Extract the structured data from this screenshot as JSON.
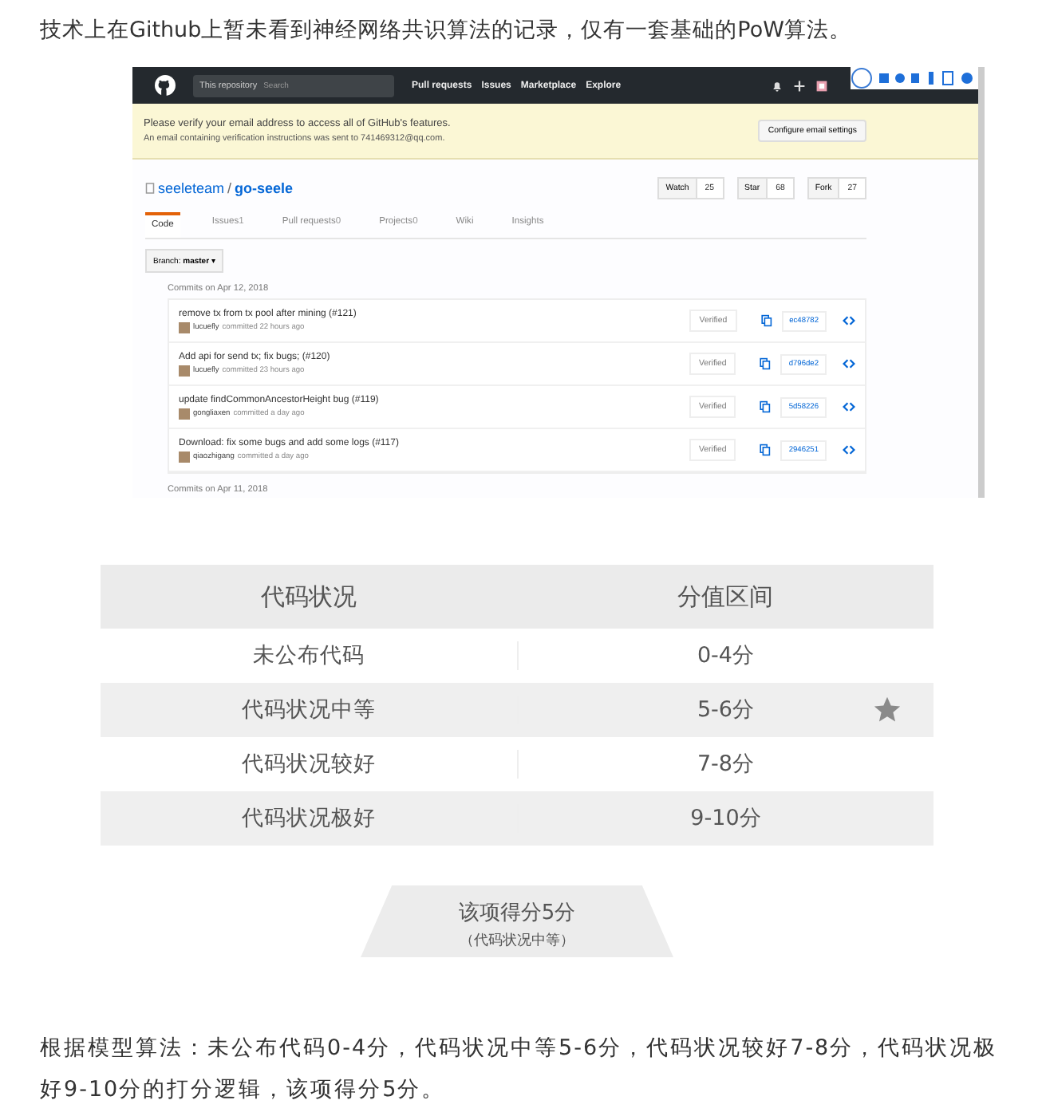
{
  "intro": "技术上在Github上暂未看到神经网络共识算法的记录，仅有一套基础的PoW算法。",
  "screenshot": {
    "nav": {
      "scope": "This repository",
      "search_placeholder": "Search",
      "links": [
        "Pull requests",
        "Issues",
        "Marketplace",
        "Explore"
      ]
    },
    "flash": {
      "title": "Please verify your email address to access all of GitHub's features.",
      "body": "An email containing verification instructions was sent to 741469312@qq.com.",
      "button": "Configure email settings"
    },
    "repo": {
      "owner": "seeleteam",
      "separator": "/",
      "name": "go-seele",
      "actions": [
        {
          "label": "Watch",
          "count": "25"
        },
        {
          "label": "Star",
          "count": "68"
        },
        {
          "label": "Fork",
          "count": "27"
        }
      ]
    },
    "tabs": [
      {
        "label": "Code",
        "selected": true
      },
      {
        "label": "Issues",
        "count": "1",
        "selected": false
      },
      {
        "label": "Pull requests",
        "count": "0",
        "selected": false
      },
      {
        "label": "Projects",
        "count": "0",
        "selected": false
      },
      {
        "label": "Wiki",
        "selected": false
      },
      {
        "label": "Insights",
        "selected": false
      }
    ],
    "branch": {
      "label": "Branch:",
      "value": "master",
      "caret": "▾"
    },
    "commit_groups": [
      {
        "date": "Commits on Apr 12, 2018",
        "commits": [
          {
            "message": "remove tx from tx pool after mining (#121)",
            "author": "lucuefly",
            "time": "committed 22 hours ago",
            "verified": "Verified",
            "sha": "ec48782"
          },
          {
            "message": "Add api for send tx; fix bugs; (#120)",
            "author": "lucuefly",
            "time": "committed 23 hours ago",
            "verified": "Verified",
            "sha": "d796de2"
          },
          {
            "message": "update findCommonAncestorHeight bug (#119)",
            "author": "gongliaxen",
            "time": "committed a day ago",
            "verified": "Verified",
            "sha": "5d58226"
          },
          {
            "message": "Download: fix some bugs and add some logs (#117)",
            "author": "qiaozhigang",
            "time": "committed a day ago",
            "verified": "Verified",
            "sha": "2946251"
          }
        ]
      },
      {
        "date": "Commits on Apr 11, 2018"
      }
    ]
  },
  "score_table": {
    "columns": [
      "代码状况",
      "分值区间"
    ],
    "rows": [
      {
        "status": "未公布代码",
        "range": "0-4分",
        "selected": false
      },
      {
        "status": "代码状况中等",
        "range": "5-6分",
        "selected": true
      },
      {
        "status": "代码状况较好",
        "range": "7-8分",
        "selected": false
      },
      {
        "status": "代码状况极好",
        "range": "9-10分",
        "selected": false
      }
    ]
  },
  "result": {
    "score": "该项得分5分",
    "note": "（代码状况中等）"
  },
  "summary": "根据模型算法：未公布代码0-4分，代码状况中等5-6分，代码状况较好7-8分，代码状况极好9-10分的打分逻辑，该项得分5分。"
}
